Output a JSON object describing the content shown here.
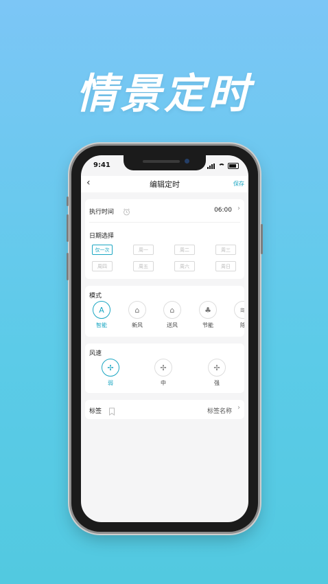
{
  "hero_title": "情景定时",
  "status_bar": {
    "time": "9:41"
  },
  "nav": {
    "back_icon": "‹",
    "title": "编辑定时",
    "save_label": "保存"
  },
  "exec_time": {
    "label": "执行时间",
    "value": "06:00"
  },
  "date_select": {
    "label": "日期选择",
    "days": [
      {
        "label": "仅一次",
        "selected": true
      },
      {
        "label": "周一",
        "selected": false
      },
      {
        "label": "周二",
        "selected": false
      },
      {
        "label": "周三",
        "selected": false
      },
      {
        "label": "周四",
        "selected": false
      },
      {
        "label": "周五",
        "selected": false
      },
      {
        "label": "周六",
        "selected": false
      },
      {
        "label": "周日",
        "selected": false
      }
    ]
  },
  "mode": {
    "label": "模式",
    "items": [
      {
        "label": "智能",
        "icon": "auto-icon",
        "selected": true
      },
      {
        "label": "新风",
        "icon": "fresh-air-icon",
        "selected": false
      },
      {
        "label": "送风",
        "icon": "fan-air-icon",
        "selected": false
      },
      {
        "label": "节能",
        "icon": "eco-icon",
        "selected": false
      },
      {
        "label": "除",
        "icon": "dehumidify-icon",
        "selected": false
      }
    ]
  },
  "wind_speed": {
    "label": "风速",
    "items": [
      {
        "label": "弱",
        "icon": "fan-low-icon",
        "selected": true
      },
      {
        "label": "中",
        "icon": "fan-mid-icon",
        "selected": false
      },
      {
        "label": "强",
        "icon": "fan-high-icon",
        "selected": false
      }
    ]
  },
  "tag": {
    "label": "标签",
    "value": "标签名称"
  },
  "colors": {
    "accent": "#1aa6c2"
  }
}
